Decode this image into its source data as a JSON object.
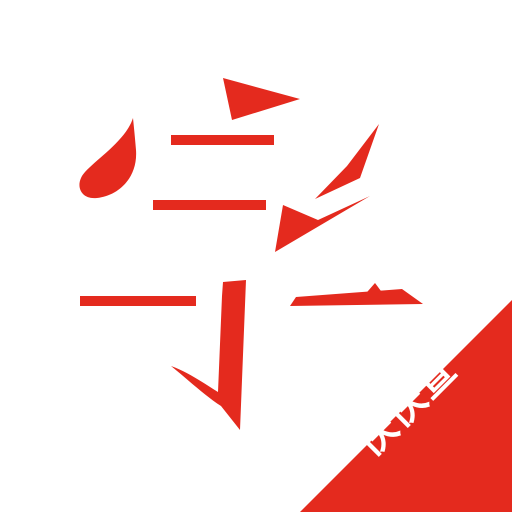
{
  "icon": {
    "ribbon": {
      "label": "快快查"
    }
  },
  "colors": {
    "accent": "#e42a1e",
    "background": "#ffffff",
    "ribbon_text": "#ffffff"
  },
  "icons": {
    "logo": "stylized-zi-character-icon"
  }
}
